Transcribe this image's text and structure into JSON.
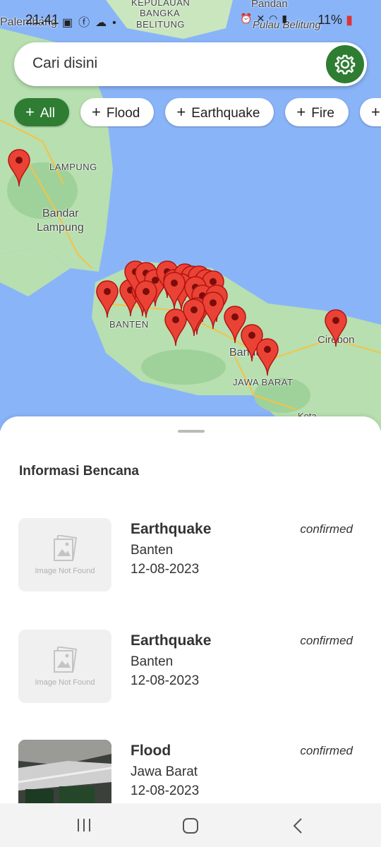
{
  "status_bar": {
    "time": "21:41",
    "battery": "11%",
    "left_icons": [
      "gallery-icon",
      "facebook-icon",
      "cloud-icon",
      "dot-icon"
    ],
    "right_icons": [
      "alarm-icon",
      "mute-icon",
      "wifi-icon",
      "signal-icon",
      "battery-icon"
    ]
  },
  "map": {
    "labels": {
      "kepulauan": "KEPULAUAN",
      "bangka": "BANGKA",
      "belitung": "BELITUNG",
      "pandan": "Pandan",
      "pulau_belitung": "Pulau Belitung",
      "palembang": "Palembang",
      "lampung": "LAMPUNG",
      "bandar": "Bandar",
      "lampung_city": "Lampung",
      "banten": "BANTEN",
      "bandung": "Bandung",
      "jawa_barat": "JAWA BARAT",
      "cirebon": "Cirebon",
      "kota": "Kota"
    },
    "marker_icon": "map-pin-icon",
    "marker_color": "#ea4335"
  },
  "search": {
    "placeholder": "Cari disini",
    "settings_icon": "gear-icon"
  },
  "filters": [
    {
      "label": "All",
      "active": true
    },
    {
      "label": "Flood",
      "active": false
    },
    {
      "label": "Earthquake",
      "active": false
    },
    {
      "label": "Fire",
      "active": false
    }
  ],
  "sheet": {
    "title": "Informasi Bencana",
    "image_not_found": "Image Not Found",
    "items": [
      {
        "type": "Earthquake",
        "location": "Banten",
        "date": "12-08-2023",
        "status": "confirmed",
        "has_image": false
      },
      {
        "type": "Earthquake",
        "location": "Banten",
        "date": "12-08-2023",
        "status": "confirmed",
        "has_image": false
      },
      {
        "type": "Flood",
        "location": "Jawa Barat",
        "date": "12-08-2023",
        "status": "confirmed",
        "has_image": true
      }
    ]
  },
  "colors": {
    "accent": "#2e7d32",
    "sea": "#8ab4f8",
    "land": "#b7dfb0",
    "marker": "#ea4335"
  },
  "nav": [
    "recent-apps-icon",
    "home-icon",
    "back-icon"
  ]
}
